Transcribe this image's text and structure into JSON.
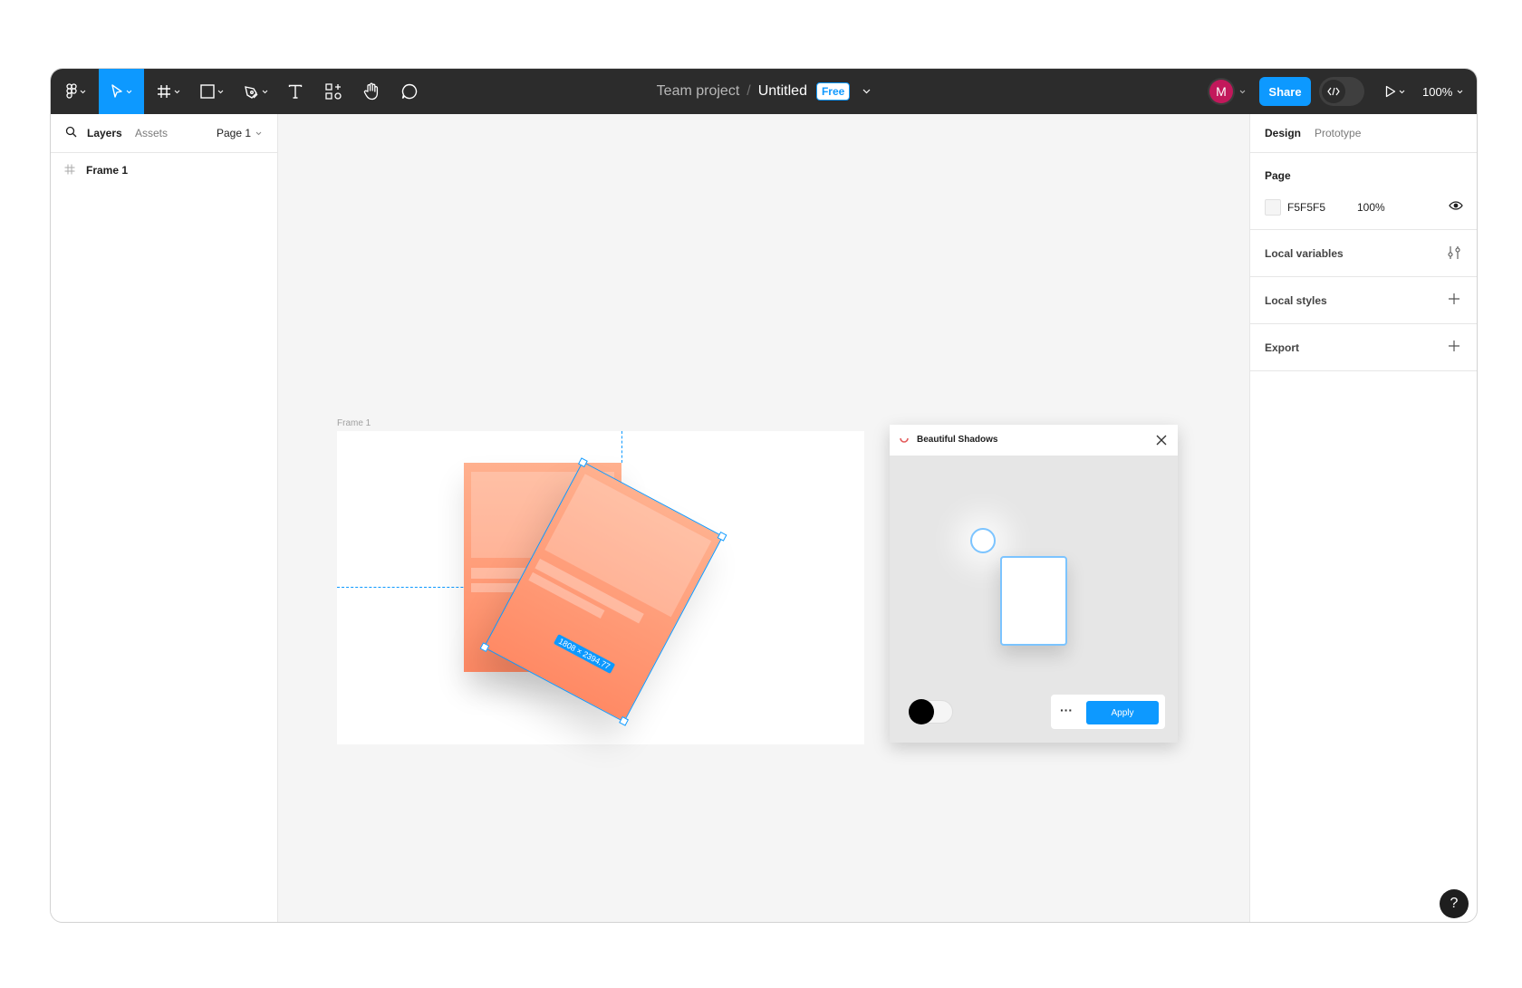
{
  "toolbar": {
    "tools": [
      {
        "name": "main-menu",
        "icon": "figma-logo-icon"
      },
      {
        "name": "move",
        "icon": "cursor-icon",
        "active": true
      },
      {
        "name": "frame",
        "icon": "frame-icon"
      },
      {
        "name": "shape",
        "icon": "rectangle-icon"
      },
      {
        "name": "pen",
        "icon": "pen-icon"
      },
      {
        "name": "text",
        "icon": "text-icon"
      },
      {
        "name": "resources",
        "icon": "components-icon"
      },
      {
        "name": "hand",
        "icon": "hand-icon"
      },
      {
        "name": "comment",
        "icon": "comment-icon"
      }
    ],
    "project": "Team project",
    "separator": "/",
    "file_name": "Untitled",
    "plan_badge": "Free",
    "avatar_initial": "M",
    "share_label": "Share",
    "zoom": "100%"
  },
  "left_panel": {
    "tab_layers": "Layers",
    "tab_assets": "Assets",
    "page_select": "Page 1",
    "layers": [
      {
        "name": "Frame 1",
        "icon": "frame-icon"
      }
    ]
  },
  "right_panel": {
    "tab_design": "Design",
    "tab_prototype": "Prototype",
    "page_heading": "Page",
    "page_color": "F5F5F5",
    "page_opacity": "100%",
    "local_variables": "Local variables",
    "local_styles": "Local styles",
    "export": "Export"
  },
  "canvas": {
    "frame_label": "Frame 1",
    "selection_size": "1808 × 2394.77"
  },
  "plugin": {
    "title": "Beautiful Shadows",
    "more": "···",
    "apply_label": "Apply"
  },
  "help": "?",
  "colors": {
    "toolbar_bg": "#2c2c2c",
    "accent": "#0d99ff",
    "canvas_bg": "#f5f5f5",
    "card_top": "#ffb08e",
    "card_bottom": "#ff8a65",
    "avatar": "#c2185b"
  }
}
